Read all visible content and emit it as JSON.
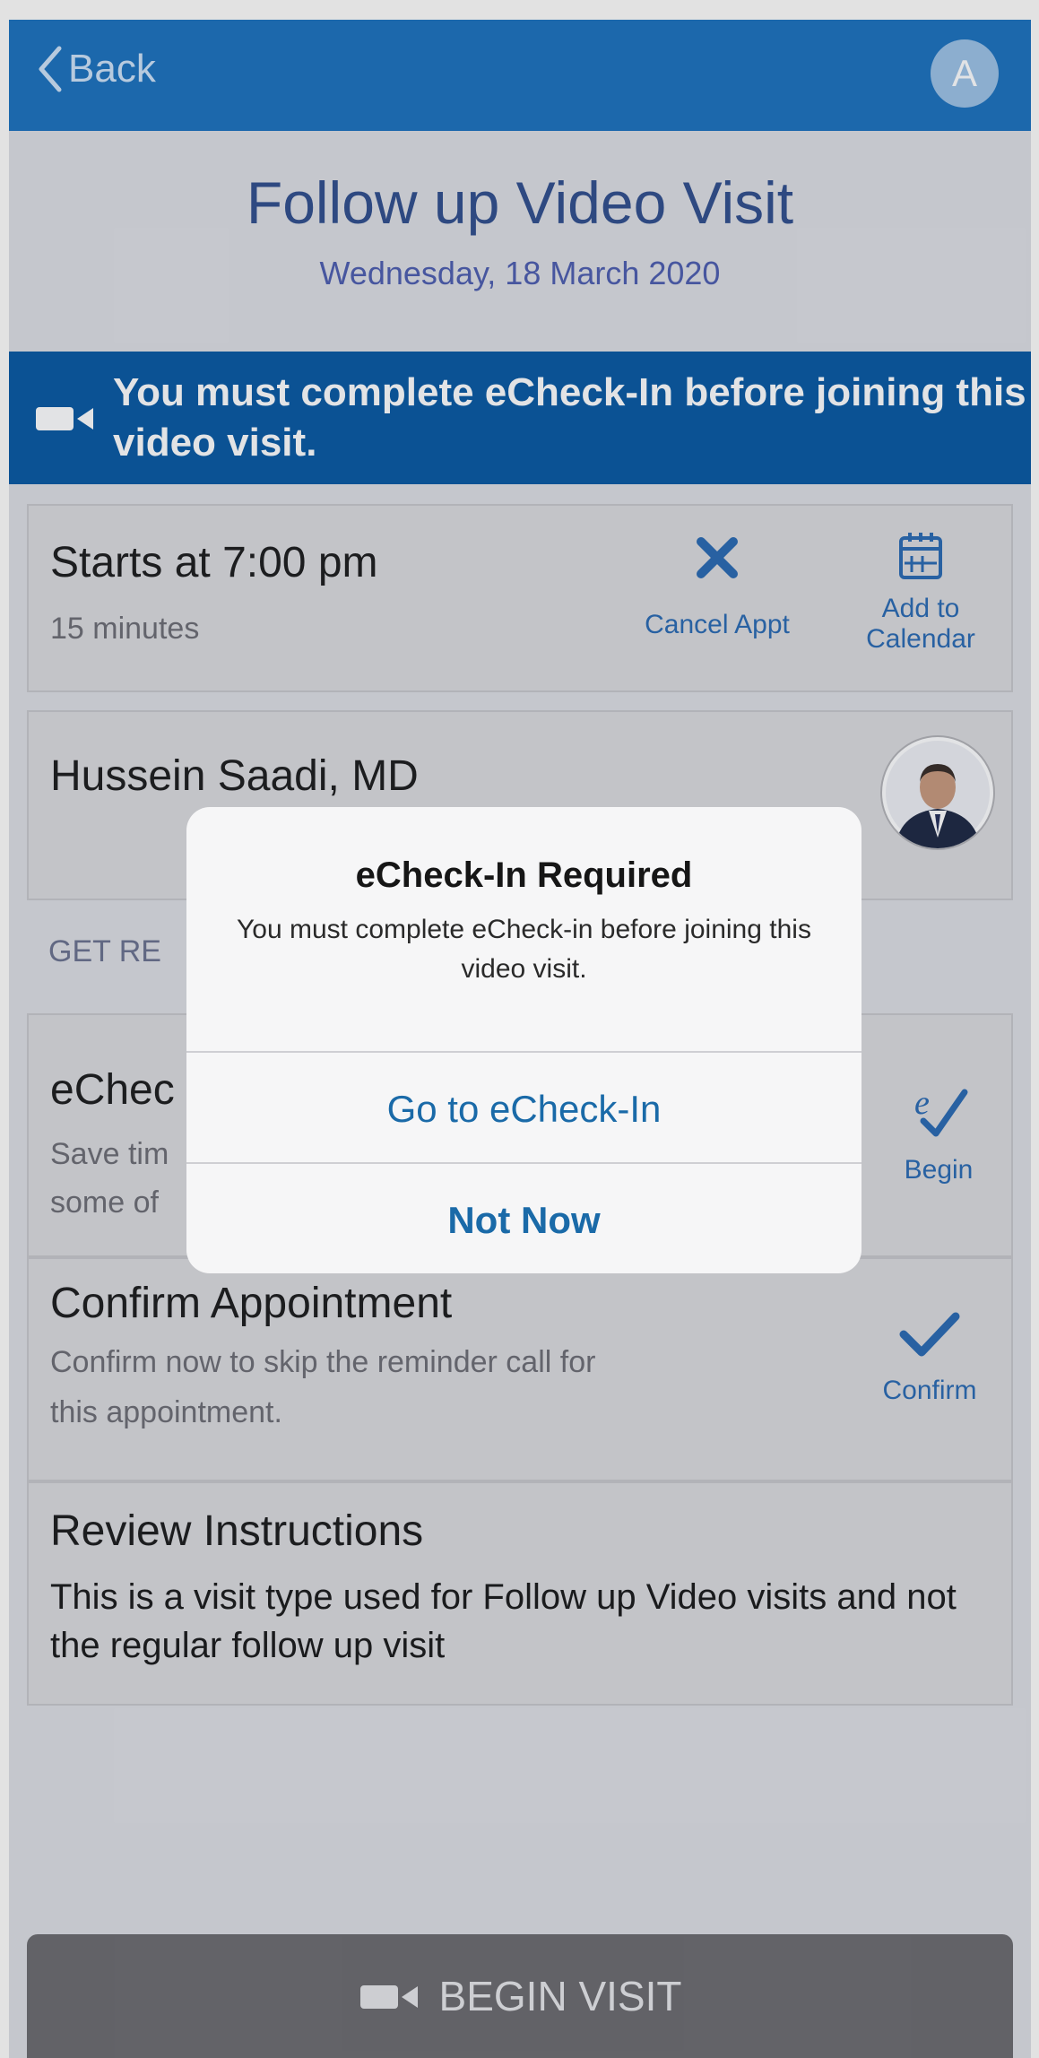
{
  "nav": {
    "back_label": "Back",
    "avatar_initial": "A"
  },
  "header": {
    "title": "Follow up Video Visit",
    "date": "Wednesday, 18 March 2020"
  },
  "banner": {
    "message": "You must complete eCheck-In before joining this video visit."
  },
  "appointment": {
    "start": "Starts at 7:00 pm",
    "duration": "15 minutes",
    "cancel_label": "Cancel Appt",
    "calendar_label_line1": "Add to",
    "calendar_label_line2": "Calendar"
  },
  "provider": {
    "name": "Hussein Saadi, MD"
  },
  "get_ready": {
    "section_label": "GET RE",
    "echeckin": {
      "title": "eChec",
      "desc_line1": "Save tim",
      "desc_line2": "some of",
      "action": "Begin"
    },
    "confirm": {
      "title": "Confirm Appointment",
      "desc_line1": "Confirm now to skip the reminder call for",
      "desc_line2": "this appointment.",
      "action": "Confirm"
    },
    "instructions": {
      "title": "Review Instructions",
      "text": "This is a visit type used for Follow up Video visits and not the regular follow up visit"
    }
  },
  "dialog": {
    "title": "eCheck-In Required",
    "message": "You must complete eCheck-in before joining this video visit.",
    "primary": "Go to eCheck-In",
    "secondary": "Not Now"
  },
  "footer": {
    "begin_label": "BEGIN VISIT"
  },
  "colors": {
    "nav": "#1e73bf",
    "banner": "#0b5aa3",
    "accent": "#2c6cb3",
    "footer": "#6e6d70"
  }
}
